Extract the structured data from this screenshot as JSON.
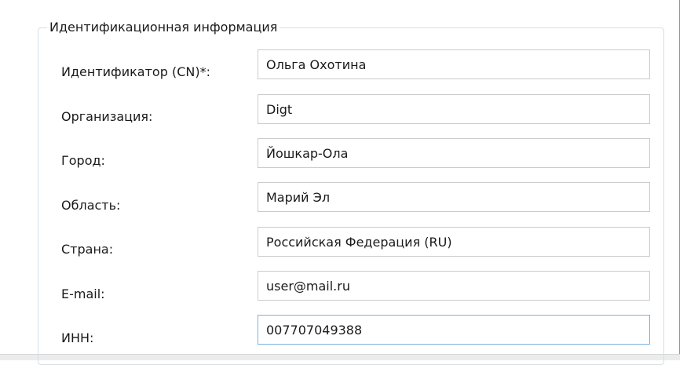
{
  "group": {
    "title": "Идентификационная информация"
  },
  "fields": [
    {
      "label": "Идентификатор (CN)*:",
      "value": "Ольга Охотина"
    },
    {
      "label": "Организация:",
      "value": "Digt"
    },
    {
      "label": "Город:",
      "value": "Йошкар-Ола"
    },
    {
      "label": "Область:",
      "value": "Марий Эл"
    },
    {
      "label": "Страна:",
      "value": "Российская Федерация (RU)"
    },
    {
      "label": "E-mail:",
      "value": "user@mail.ru"
    },
    {
      "label": "ИНН:",
      "value": "007707049388"
    }
  ]
}
